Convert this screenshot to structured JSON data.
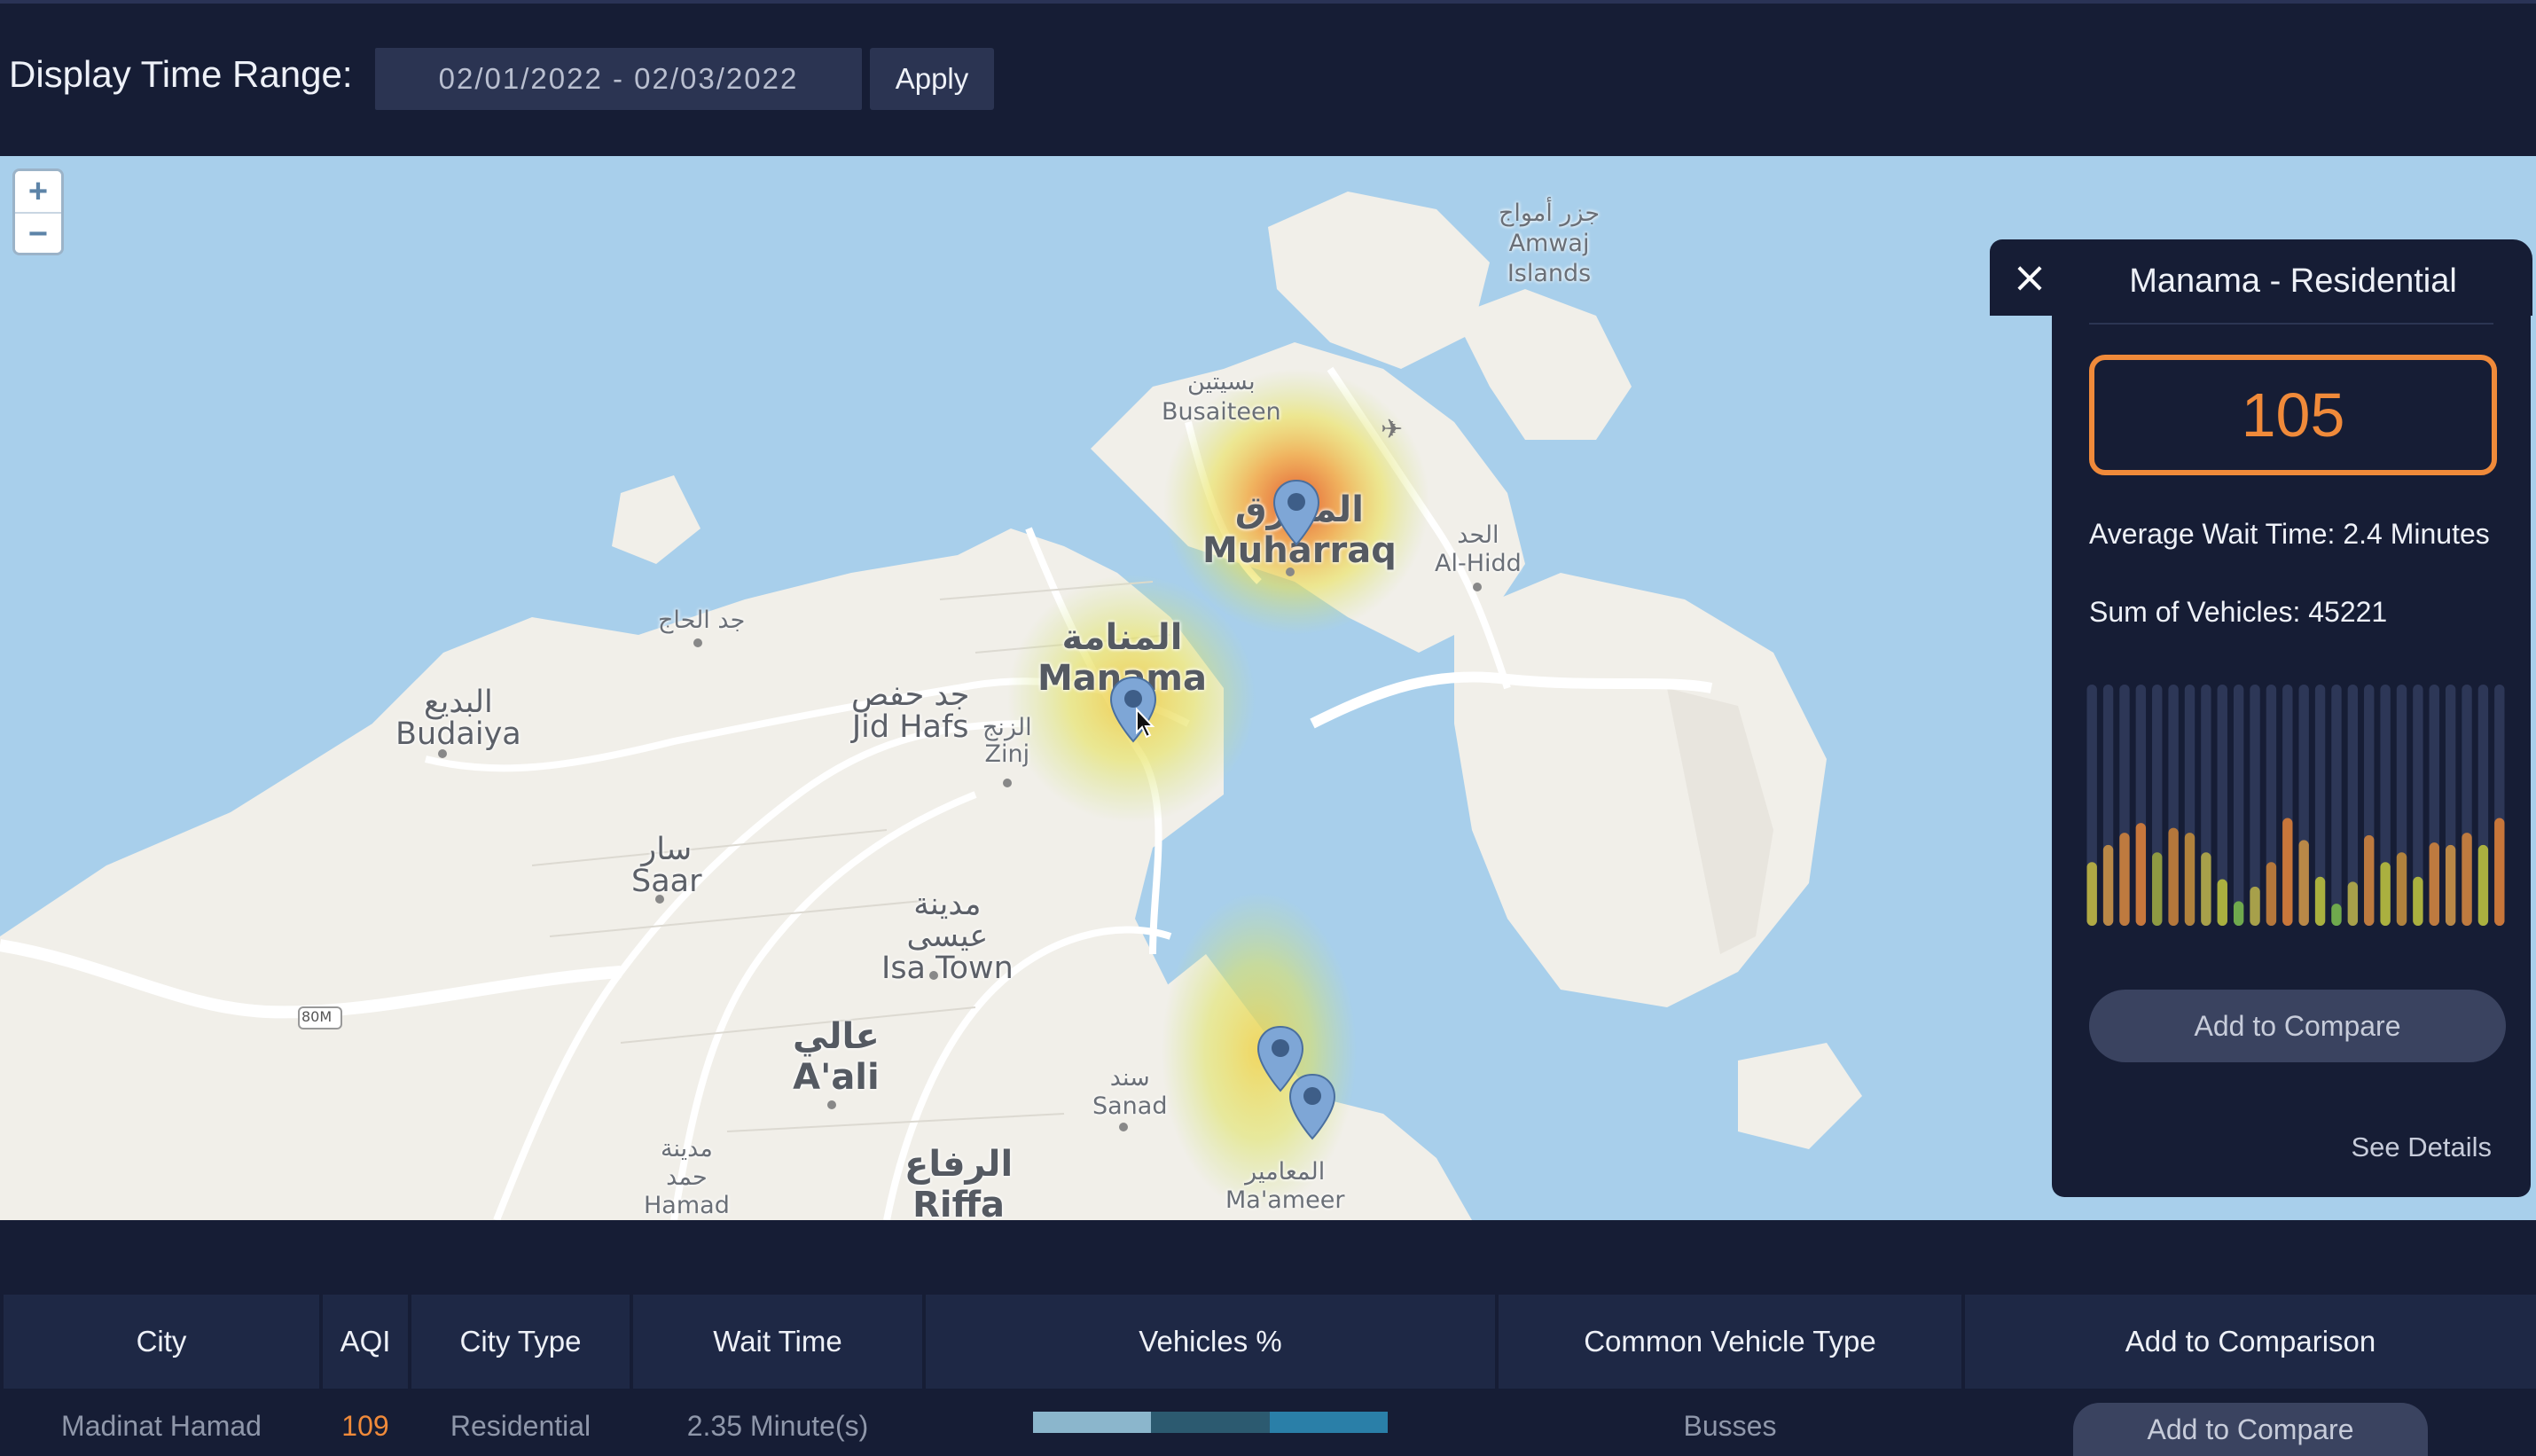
{
  "filter": {
    "label": "Display Time Range:",
    "date_range_value": "02/01/2022 - 02/03/2022",
    "apply_label": "Apply"
  },
  "map": {
    "zoom_in": "+",
    "zoom_out": "−",
    "labels": {
      "amwaj_ar": "جزر أمواج",
      "amwaj_en1": "Amwaj",
      "amwaj_en2": "Islands",
      "busaiteen_ar": "بسيتين",
      "busaiteen_en": "Busaiteen",
      "muharraq_ar": "المحرق",
      "muharraq_en": "Muharraq",
      "hidd_ar": "الحد",
      "hidd_en": "Al-Hidd",
      "manama_ar": "المنامة",
      "manama_en": "Manama",
      "jidalhaj_ar": "جد الحاج",
      "jidhafs_ar": "جد حفص",
      "jidhafs_en": "Jid Hafs",
      "zinj_ar": "الزنج",
      "zinj_en": "Zinj",
      "budaiya_ar": "البديع",
      "budaiya_en": "Budaiya",
      "saar_ar": "سار",
      "saar_en": "Saar",
      "isatown_ar1": "مدينة",
      "isatown_ar2": "عيسى",
      "isatown_en": "Isa Town",
      "aali_ar": "عالي",
      "aali_en": "A'ali",
      "sanad_ar": "سند",
      "sanad_en": "Sanad",
      "hamad_ar1": "مدينة",
      "hamad_ar2": "حمد",
      "hamad_en": "Hamad",
      "riffa_ar": "الرفاع",
      "riffa_en": "Riffa",
      "maameer_ar": "المعامير",
      "maameer_en": "Ma'ameer",
      "road": "80M"
    },
    "icons": [
      "zoom-in-icon",
      "zoom-out-icon",
      "map-pin-icon",
      "airport-icon",
      "cursor-icon"
    ]
  },
  "panel": {
    "close_icon": "×",
    "title": "Manama - Residential",
    "aqi_value": "105",
    "avg_wait": "Average Wait Time: 2.4 Minutes",
    "sum_vehicles": "Sum of Vehicles: 45221",
    "compare_label": "Add to Compare",
    "see_details": "See Details",
    "bar_levels": [
      0.26,
      0.33,
      0.38,
      0.42,
      0.3,
      0.4,
      0.38,
      0.3,
      0.19,
      0.1,
      0.16,
      0.26,
      0.44,
      0.35,
      0.2,
      0.09,
      0.18,
      0.37,
      0.26,
      0.3,
      0.2,
      0.34,
      0.33,
      0.38,
      0.33,
      0.44
    ],
    "bar_colors": [
      "#b0a944",
      "#b98847",
      "#be7a3f",
      "#c7773c",
      "#8e9a42",
      "#b5773b",
      "#b0823d",
      "#a7a04a",
      "#aab03f",
      "#6fa94d",
      "#a7a04a",
      "#b5773b",
      "#c8763a",
      "#b98847",
      "#aab03f",
      "#6fa94d",
      "#a7a04a",
      "#be7a3f",
      "#aab03f",
      "#b0823d",
      "#aab03f",
      "#be7a3f",
      "#b98847",
      "#be7a3f",
      "#aab03f",
      "#c8763a"
    ],
    "accent_color": "#f08a3a"
  },
  "table": {
    "headers": [
      "City",
      "AQI",
      "City Type",
      "Wait Time",
      "Vehicles %",
      "Common Vehicle Type",
      "Add to Comparison"
    ],
    "rows": [
      {
        "city": "Madinat Hamad",
        "aqi": "109",
        "city_type": "Residential",
        "wait_time": "2.35 Minute(s)",
        "vehicle_share_colors": [
          "#8bb6cc",
          "#2c5a70",
          "#2a7fa8"
        ],
        "common_vehicle": "Busses",
        "compare_label": "Add to Compare"
      }
    ]
  }
}
